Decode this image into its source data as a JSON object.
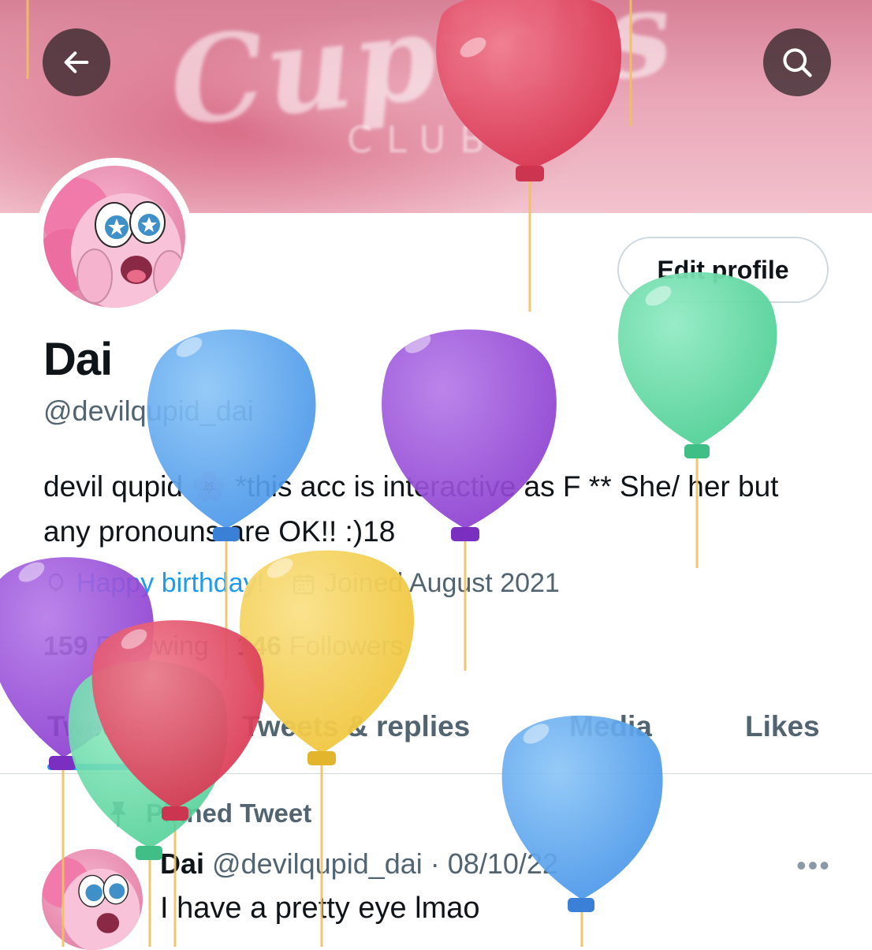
{
  "header": {
    "back_icon": "arrow-left-icon",
    "search_icon": "search-icon"
  },
  "banner": {
    "script_text": "Cupid's",
    "sub_text": "CLUB"
  },
  "profile": {
    "edit_label": "Edit profile",
    "name": "Dai",
    "handle": "@devilqupid_dai",
    "bio": "devil qupid 🌸 *this acc is interactive as F ** She/ her but any pronouns are OK!! :)18",
    "birthday_label": "Happy birthday!",
    "joined_label": "Joined August 2021",
    "following_count": "159",
    "following_label": "Following",
    "followers_count": "146",
    "followers_label": "Followers"
  },
  "tabs": [
    "Tweets",
    "Tweets & replies",
    "Media",
    "Likes"
  ],
  "pinned_tweet": {
    "pinned_label": "Pinned Tweet",
    "author": "Dai",
    "handle_date": "@devilqupid_dai · 08/10/22",
    "text": "I have a pretty eye lmao",
    "more": "•••"
  },
  "colors": {
    "accent": "#1d9bf0",
    "balloon_red": "#e04a63",
    "balloon_blue": "#5aa7f0",
    "balloon_purple": "#9b4fd6",
    "balloon_green": "#63d9a3",
    "balloon_yellow": "#f2cf4d"
  }
}
